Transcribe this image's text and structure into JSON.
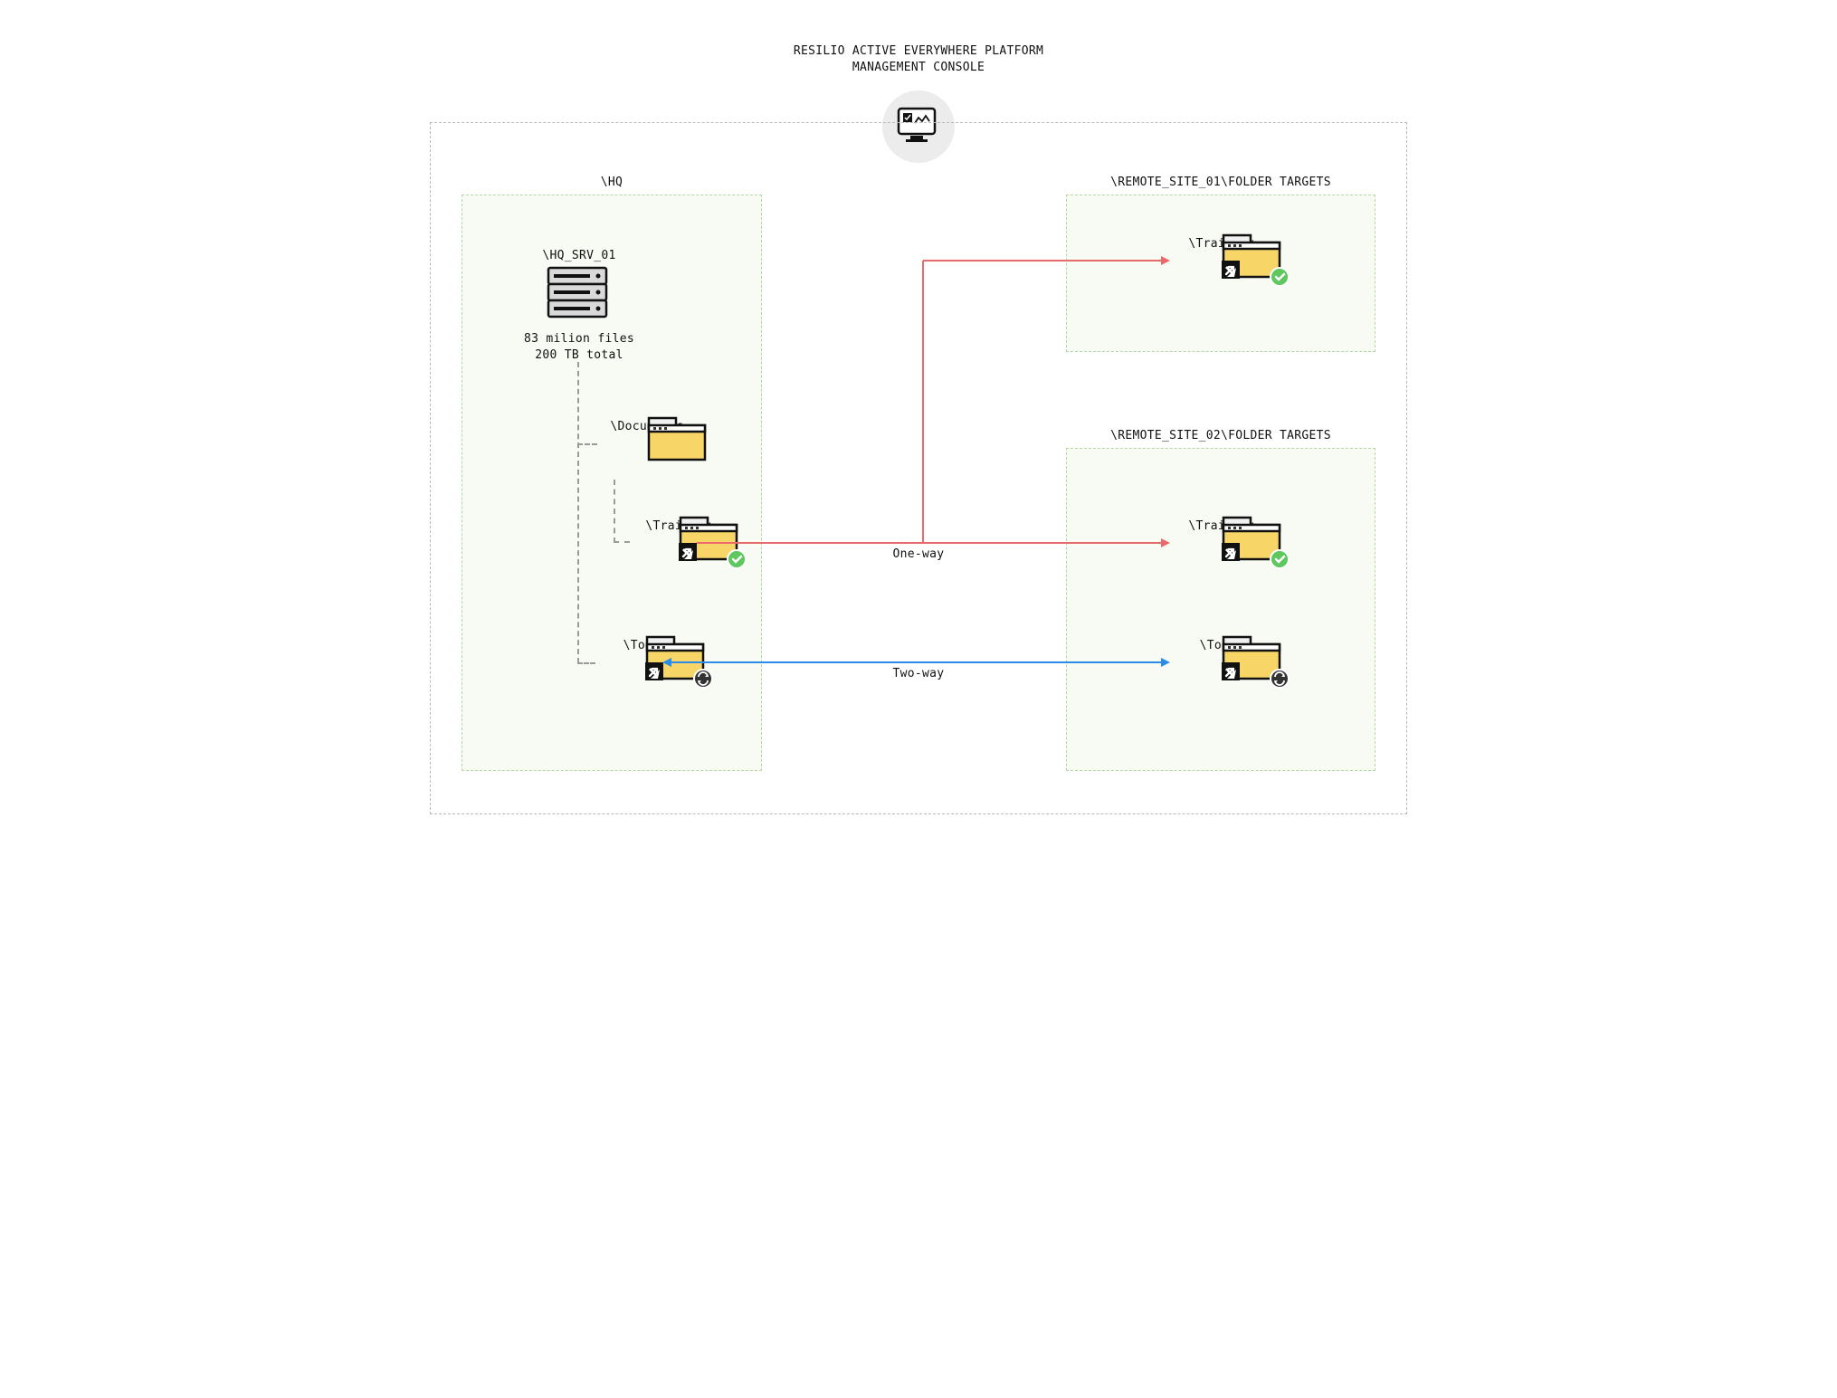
{
  "title": {
    "line1": "Resilio Active Everywhere Platform",
    "line2": "Management Console"
  },
  "zones": {
    "hq": {
      "label": "\\HQ"
    },
    "remote1": {
      "label": "\\REMOTE_SITE_01\\FOLDER TARGETS"
    },
    "remote2": {
      "label": "\\REMOTE_SITE_02\\FOLDER TARGETS"
    }
  },
  "hq_server": {
    "name": "\\HQ_SRV_01",
    "stat1": "83 milion files",
    "stat2": "200 TB total"
  },
  "hq_folders": {
    "documents": "\\Documents",
    "training": "\\Training",
    "tools": "\\Tools"
  },
  "remote1_folders": {
    "training": "\\Training"
  },
  "remote2_folders": {
    "training": "\\Training",
    "tools": "\\Tools"
  },
  "arrows": {
    "one_way": "One-way",
    "two_way": "Two-way"
  },
  "icons": {
    "console": "console-monitor-icon",
    "server": "server-rack-icon",
    "folder": "folder-icon",
    "shortcut": "folder-shortcut-icon",
    "check": "check-badge-icon",
    "sync": "sync-badge-icon"
  },
  "colors": {
    "one_way": "#e96a6a",
    "two_way": "#2a8ce6",
    "zone_bg": "#f7fbf4",
    "zone_border": "#b6d6a6"
  }
}
